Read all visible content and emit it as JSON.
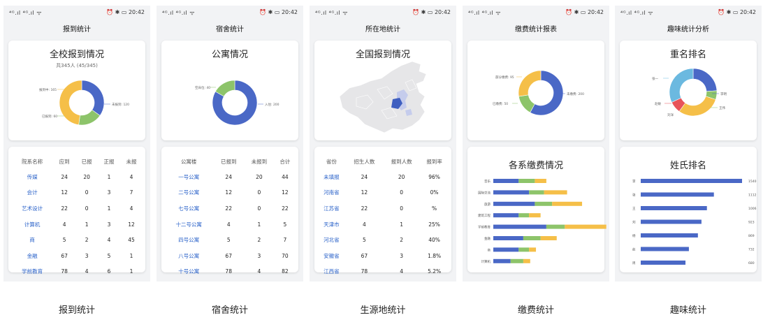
{
  "status_bar": {
    "signal": "⁴ᴳ.ıl ⁴ᴳ.ıl ᯤ",
    "icons": "⏰ ✱ ▭",
    "time": "20:42"
  },
  "colors": {
    "blue": "#4a68c6",
    "green": "#8dc46a",
    "yellow": "#f5bf48",
    "red": "#e8545a",
    "cyan": "#6bb9e0",
    "link": "#2a62c9"
  },
  "captions": [
    "报到统计",
    "宿舍统计",
    "生源地统计",
    "缴费统计",
    "趣味统计"
  ],
  "screen1": {
    "page_title": "报到统计",
    "card_title": "全校报到情况",
    "card_subtitle": "共345人 (45/345)",
    "donut_labels": [
      "未报到: 120",
      "已报到: 60",
      "报到中: 165"
    ],
    "headers": [
      "院系名称",
      "应到",
      "已报",
      "正报",
      "未报"
    ],
    "rows": [
      [
        "传媒",
        "24",
        "20",
        "1",
        "4"
      ],
      [
        "会计",
        "12",
        "0",
        "3",
        "7"
      ],
      [
        "艺术设计",
        "22",
        "0",
        "1",
        "4"
      ],
      [
        "计算机",
        "4",
        "1",
        "3",
        "12"
      ],
      [
        "商",
        "5",
        "2",
        "4",
        "45"
      ],
      [
        "金融",
        "67",
        "3",
        "5",
        "1"
      ],
      [
        "学前教育",
        "78",
        "4",
        "6",
        "1"
      ]
    ]
  },
  "screen2": {
    "page_title": "宿舍统计",
    "card_title": "公寓情况",
    "donut_labels": [
      "空床位: 40",
      "入住: 200"
    ],
    "headers": [
      "公寓楼",
      "已报到",
      "未报到",
      "合计"
    ],
    "rows": [
      [
        "一号公寓",
        "24",
        "20",
        "44"
      ],
      [
        "二号公寓",
        "12",
        "0",
        "12"
      ],
      [
        "七号公寓",
        "22",
        "0",
        "22"
      ],
      [
        "十二号公寓",
        "4",
        "1",
        "5"
      ],
      [
        "四号公寓",
        "5",
        "2",
        "7"
      ],
      [
        "八号公寓",
        "67",
        "3",
        "70"
      ],
      [
        "十号公寓",
        "78",
        "4",
        "82"
      ]
    ]
  },
  "screen3": {
    "page_title": "所在地统计",
    "card_title": "全国报到情况",
    "headers": [
      "省份",
      "招生人数",
      "报到人数",
      "报到率"
    ],
    "rows": [
      [
        "未填报",
        "24",
        "20",
        "96%"
      ],
      [
        "河南省",
        "12",
        "0",
        "0%"
      ],
      [
        "江苏省",
        "22",
        "0",
        "%"
      ],
      [
        "天津市",
        "4",
        "1",
        "25%"
      ],
      [
        "河北省",
        "5",
        "2",
        "40%"
      ],
      [
        "安徽省",
        "67",
        "3",
        "1.8%"
      ],
      [
        "江西省",
        "78",
        "4",
        "5.2%"
      ]
    ]
  },
  "screen4": {
    "page_title": "缴费统计报表",
    "donut_labels": [
      "未缴费: 200",
      "已缴费: 50",
      "部分缴费: 95"
    ],
    "card2_title": "各系缴费情况"
  },
  "screen5": {
    "page_title": "趣味统计分析",
    "card_title": "重名排名",
    "donut_labels": [
      "张一",
      "李明",
      "王伟",
      "赵敏",
      "刘洋"
    ],
    "card2_title": "姓氏排名"
  },
  "chart_data": [
    {
      "type": "pie",
      "chart": "全校报到情况",
      "labels": [
        "未报到",
        "已报到",
        "报到中"
      ],
      "values": [
        120,
        60,
        165
      ],
      "colors": [
        "#4a68c6",
        "#8dc46a",
        "#f5bf48"
      ]
    },
    {
      "type": "pie",
      "chart": "公寓情况",
      "labels": [
        "入住",
        "空床位"
      ],
      "values": [
        200,
        40
      ],
      "colors": [
        "#4a68c6",
        "#8dc46a"
      ]
    },
    {
      "type": "pie",
      "chart": "缴费",
      "labels": [
        "未缴费",
        "已缴费",
        "部分缴费"
      ],
      "values": [
        200,
        50,
        95
      ],
      "colors": [
        "#4a68c6",
        "#8dc46a",
        "#f5bf48"
      ]
    },
    {
      "type": "pie",
      "chart": "重名排名",
      "labels": [
        "张一",
        "李明",
        "王伟",
        "赵敏",
        "刘洋"
      ],
      "values": [
        24,
        6,
        30,
        8,
        32
      ],
      "colors": [
        "#4a68c6",
        "#8dc46a",
        "#f5bf48",
        "#e8545a",
        "#6bb9e0"
      ]
    },
    {
      "type": "bar",
      "chart": "各系缴费情况",
      "stacked": true,
      "orientation": "horizontal",
      "categories": [
        "音乐",
        "国际交流",
        "旅游",
        "建筑工程",
        "学前教育",
        "金融",
        "商",
        "计算机"
      ],
      "series": [
        {
          "values": [
            22,
            31,
            36,
            22,
            46,
            26,
            22,
            15
          ]
        },
        {
          "values": [
            14,
            13,
            15,
            9,
            16,
            15,
            9,
            11
          ]
        },
        {
          "values": [
            10,
            20,
            26,
            10,
            36,
            14,
            6,
            6
          ]
        }
      ]
    },
    {
      "type": "bar",
      "chart": "姓氏排名",
      "orientation": "horizontal",
      "categories": [
        "李",
        "张",
        "王",
        "刘",
        "杨",
        "赵",
        "周"
      ],
      "values": [
        1540,
        1112,
        1006,
        923,
        869,
        732,
        680
      ]
    }
  ]
}
